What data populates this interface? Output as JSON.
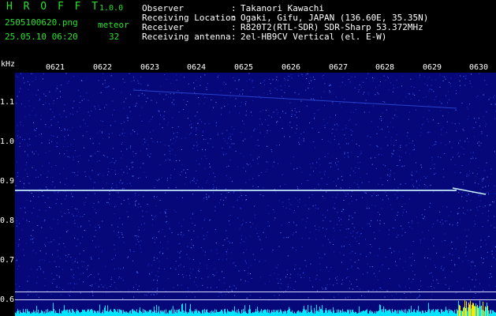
{
  "header": {
    "app_name": "H R O F F T",
    "version": "1.0.0",
    "filename": "2505100620.png",
    "datetime": "25.05.10 06:20",
    "meteor_label": "meteor",
    "meteor_count": "32"
  },
  "info": [
    {
      "label": "Observer",
      "value": "Takanori Kawachi"
    },
    {
      "label": "Receiving Location",
      "value": "Ogaki, Gifu, JAPAN (136.60E, 35.35N)"
    },
    {
      "label": "Receiver",
      "value": "R820T2(RTL-SDR) SDR-Sharp 53.372MHz"
    },
    {
      "label": "Receiving antenna",
      "value": "2el-HB9CV Vertical (el. E-W)"
    }
  ],
  "axes": {
    "y_unit": "kHz",
    "y_ticks": [
      "1.1",
      "1.0",
      "0.9",
      "0.8",
      "0.7",
      "0.6"
    ],
    "x_ticks": [
      "0621",
      "0622",
      "0623",
      "0624",
      "0625",
      "0626",
      "0627",
      "0628",
      "0629",
      "0630"
    ]
  },
  "spectrogram": {
    "background": "#06087a",
    "carrier_color": "#c8f0ff",
    "meteor_color": "#e8ff80",
    "carrier_freq_khz": 0.88
  }
}
